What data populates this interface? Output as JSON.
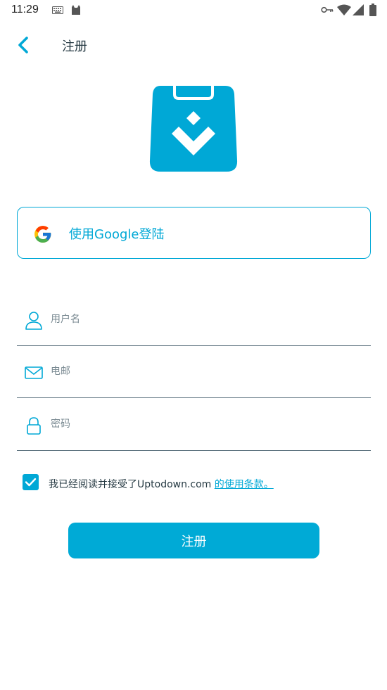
{
  "status_bar": {
    "time": "11:29",
    "icons": [
      "keyboard-icon",
      "cat-icon",
      "vpn-key-icon",
      "wifi-icon",
      "signal-icon",
      "battery-icon"
    ]
  },
  "toolbar": {
    "back_icon": "chevron-left-icon",
    "title": "注册"
  },
  "logo": {
    "icon": "uptodown-bag-logo",
    "color": "#00a8d6"
  },
  "google": {
    "label": "使用Google登陆",
    "icon": "google-g-icon"
  },
  "form": {
    "username": {
      "placeholder": "用户名",
      "value": "",
      "icon": "user-icon"
    },
    "email": {
      "placeholder": "电邮",
      "value": "",
      "icon": "envelope-icon"
    },
    "password": {
      "placeholder": "密码",
      "value": "",
      "icon": "lock-icon"
    }
  },
  "terms": {
    "checked": true,
    "text": "我已经阅读并接受了Uptodown.com ",
    "link": "的使用条款。"
  },
  "register_button": {
    "label": "注册"
  },
  "colors": {
    "accent": "#00a8d6",
    "text": "#263a43",
    "divider": "#5f7480"
  }
}
